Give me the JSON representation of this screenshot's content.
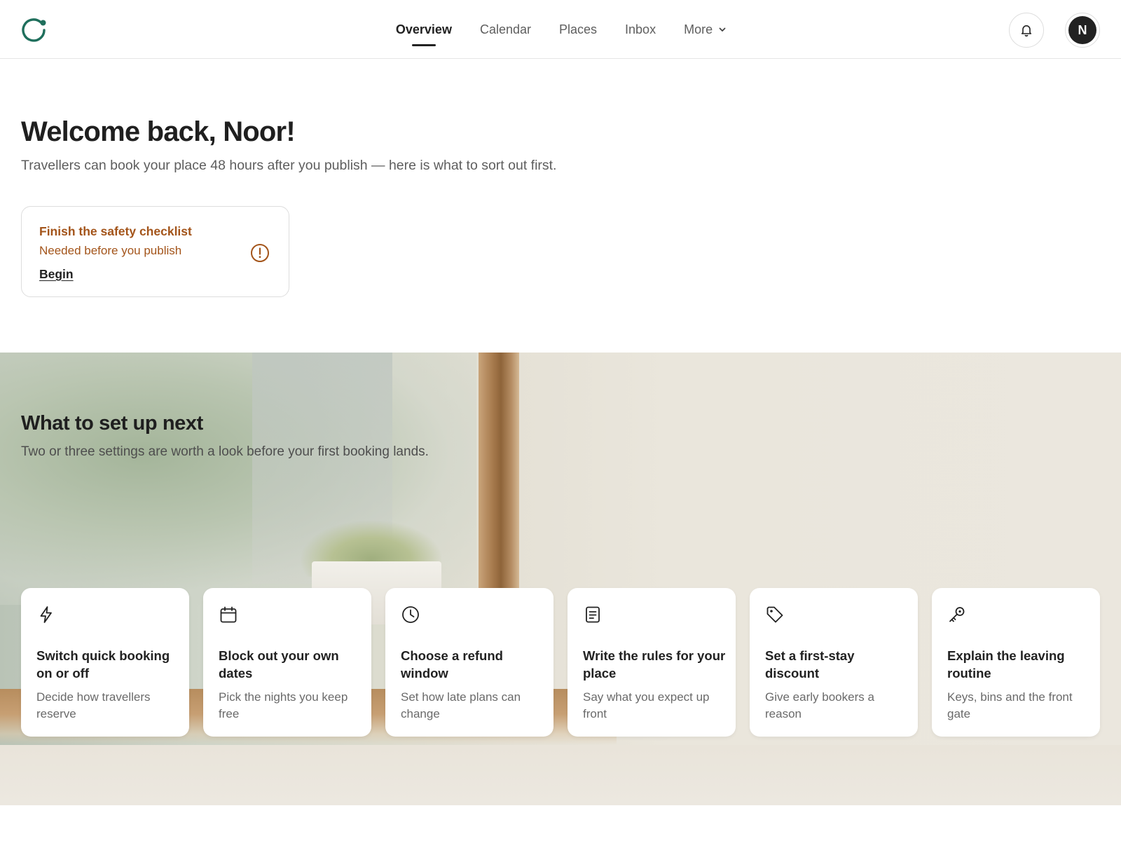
{
  "header": {
    "nav": [
      {
        "label": "Overview",
        "active": true
      },
      {
        "label": "Calendar",
        "active": false
      },
      {
        "label": "Places",
        "active": false
      },
      {
        "label": "Inbox",
        "active": false
      },
      {
        "label": "More",
        "active": false
      }
    ],
    "avatar_initial": "N",
    "icons": {
      "logo": "brand-ring-logo",
      "notifications": "bell-icon",
      "more": "chevron-down-icon"
    }
  },
  "welcome": {
    "title": "Welcome back, Noor!",
    "subtitle": "Travellers can book your place 48 hours after you publish — here is what to sort out first."
  },
  "task": {
    "title": "Finish the safety checklist",
    "subtitle": "Needed before you publish",
    "action": "Begin",
    "icon": "exclamation-circle-icon",
    "color": "#a3541a"
  },
  "setup": {
    "title": "What to set up next",
    "subtitle": "Two or three settings are worth a look before your first booking lands.",
    "cards": [
      {
        "icon": "lightning-icon",
        "title": "Switch quick booking on or off",
        "desc": "Decide how travellers reserve"
      },
      {
        "icon": "calendar-icon",
        "title": "Block out your own dates",
        "desc": "Pick the nights you keep free"
      },
      {
        "icon": "clock-icon",
        "title": "Choose a refund window",
        "desc": "Set how late plans can change"
      },
      {
        "icon": "document-icon",
        "title": "Write the rules for your place",
        "desc": "Say what you expect up front"
      },
      {
        "icon": "tag-icon",
        "title": "Set a first-stay discount",
        "desc": "Give early bookers a reason"
      },
      {
        "icon": "key-icon",
        "title": "Explain the leaving routine",
        "desc": "Keys, bins and the front gate"
      }
    ]
  },
  "colors": {
    "brand": "#1f6f5c",
    "text": "#222222",
    "muted": "#5e5e5e",
    "warning": "#a3541a"
  }
}
